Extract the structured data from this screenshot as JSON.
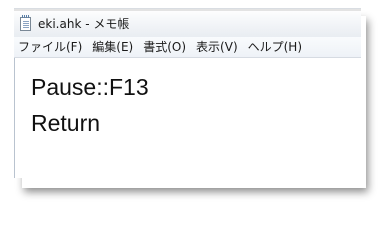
{
  "window": {
    "title": "eki.ahk - メモ帳",
    "icon": "notepad-icon"
  },
  "menubar": {
    "items": [
      {
        "label": "ファイル(F)"
      },
      {
        "label": "編集(E)"
      },
      {
        "label": "書式(O)"
      },
      {
        "label": "表示(V)"
      },
      {
        "label": "ヘルプ(H)"
      }
    ]
  },
  "editor": {
    "lines": [
      "Pause::F13",
      "Return"
    ]
  }
}
